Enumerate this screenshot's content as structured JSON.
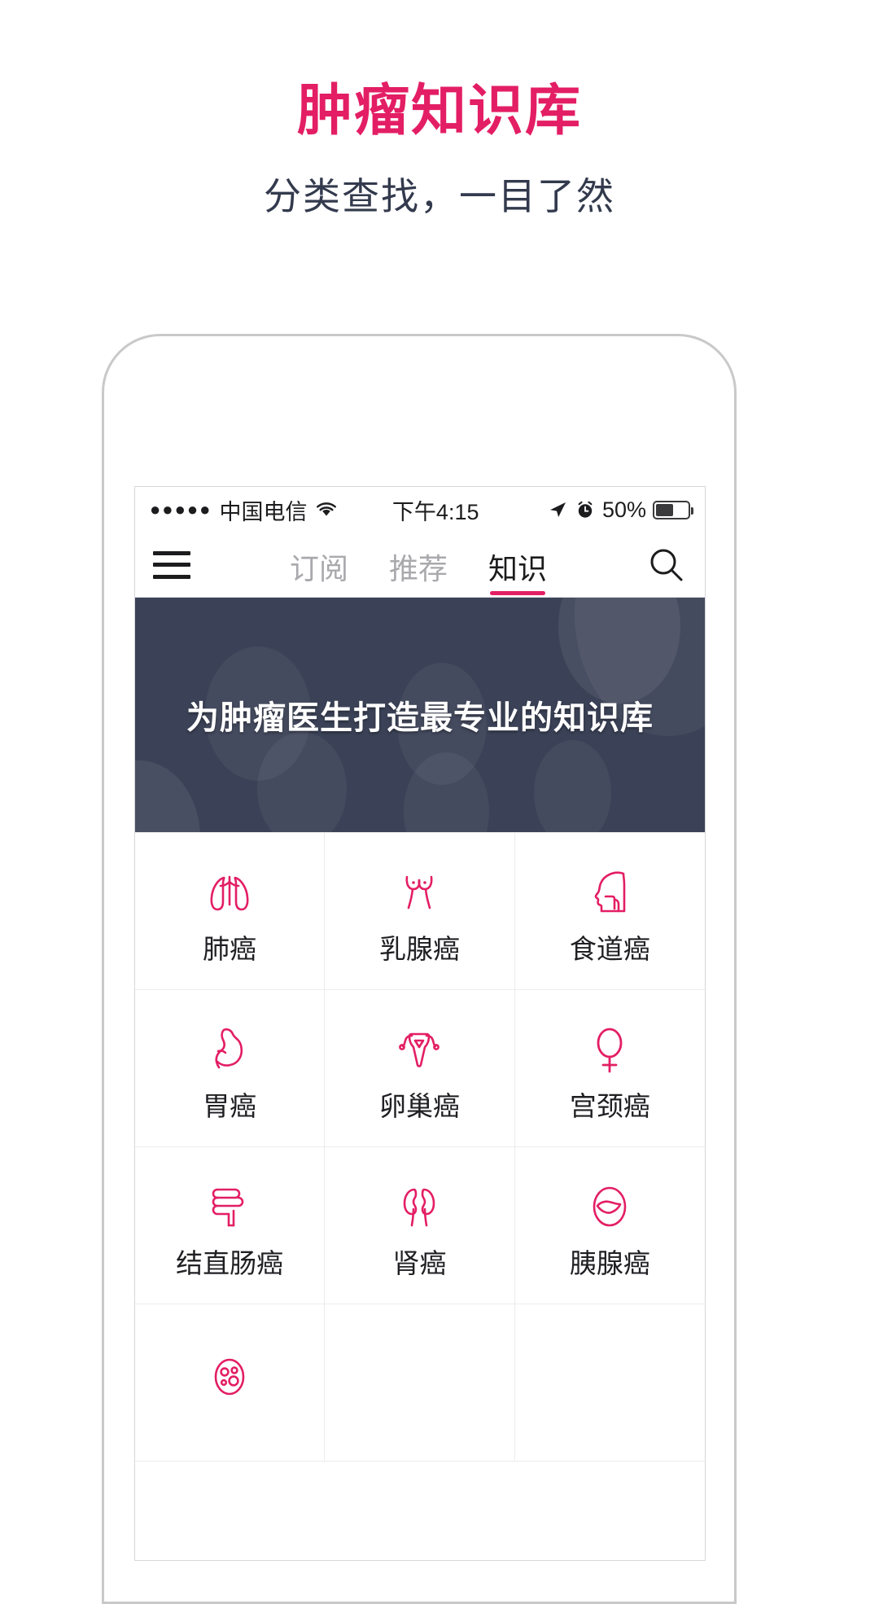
{
  "promo": {
    "title": "肿瘤知识库",
    "subtitle": "分类查找，一目了然",
    "title_color": "#e31e64",
    "subtitle_color": "#333a4d"
  },
  "phone": {
    "statusbar": {
      "signal_dots": "●●●●●",
      "carrier": "中国电信",
      "wifi_icon": "wifi-icon",
      "time": "下午4:15",
      "location_icon": "location-arrow-icon",
      "alarm_icon": "alarm-clock-icon",
      "battery_percent": "50%",
      "battery_level": 50
    },
    "navbar": {
      "menu_icon": "hamburger-menu-icon",
      "search_icon": "search-icon",
      "tabs": [
        {
          "label": "订阅",
          "active": false
        },
        {
          "label": "推荐",
          "active": false
        },
        {
          "label": "知识",
          "active": true
        }
      ],
      "active_underline_color": "#e31e64"
    },
    "banner": {
      "text": "为肿瘤医生打造最专业的知识库",
      "background_color": "#3b4257"
    },
    "grid": {
      "accent_color": "#e31e64",
      "items": [
        {
          "label": "肺癌",
          "icon": "lungs-icon"
        },
        {
          "label": "乳腺癌",
          "icon": "breast-icon"
        },
        {
          "label": "食道癌",
          "icon": "head-throat-icon"
        },
        {
          "label": "胃癌",
          "icon": "stomach-icon"
        },
        {
          "label": "卵巢癌",
          "icon": "uterus-ovaries-icon"
        },
        {
          "label": "宫颈癌",
          "icon": "female-symbol-icon"
        },
        {
          "label": "结直肠癌",
          "icon": "colon-intestine-icon"
        },
        {
          "label": "肾癌",
          "icon": "kidneys-icon"
        },
        {
          "label": "胰腺癌",
          "icon": "pancreas-icon"
        },
        {
          "label": "",
          "icon": "lymphoma-cells-icon"
        }
      ]
    }
  }
}
